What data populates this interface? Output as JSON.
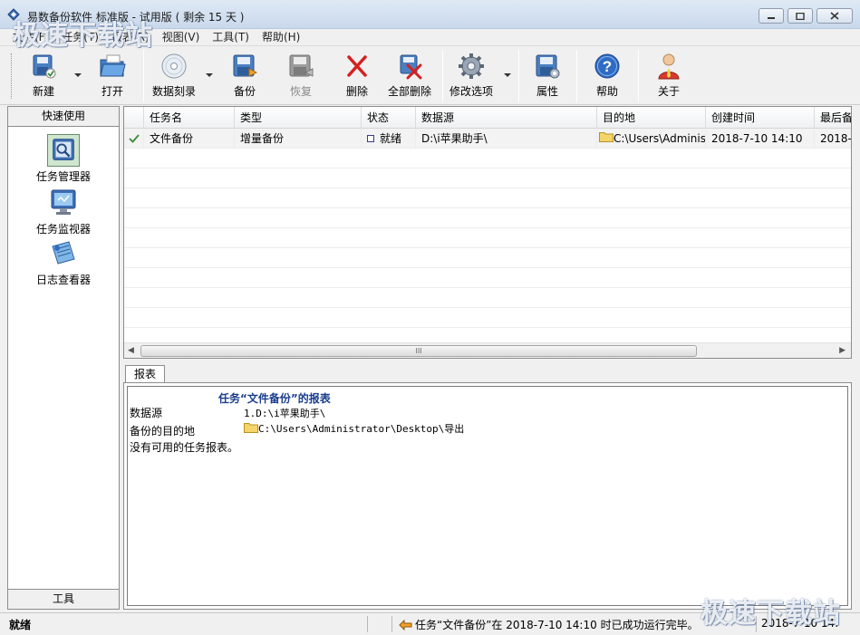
{
  "window": {
    "title": "易数备份软件 标准版 - 试用版 ( 剩余 15 天 )"
  },
  "menu": [
    "文件(F)",
    "任务(T)",
    "报表(R)",
    "视图(V)",
    "工具(T)",
    "帮助(H)"
  ],
  "toolbar": {
    "new": "新建",
    "open": "打开",
    "burn": "数据刻录",
    "backup": "备份",
    "restore": "恢复",
    "delete": "删除",
    "delete_all": "全部删除",
    "options": "修改选项",
    "properties": "属性",
    "help": "帮助",
    "about": "关于"
  },
  "sidebar": {
    "header": "快速使用",
    "items": [
      {
        "label": "任务管理器",
        "icon": "task-manager-icon"
      },
      {
        "label": "任务监视器",
        "icon": "task-monitor-icon"
      },
      {
        "label": "日志查看器",
        "icon": "log-viewer-icon"
      }
    ],
    "footer": "工具"
  },
  "table": {
    "columns": [
      "任务名",
      "类型",
      "状态",
      "数据源",
      "目的地",
      "创建时间",
      "最后备"
    ],
    "rows": [
      {
        "name": "文件备份",
        "type": "增量备份",
        "status": "就绪",
        "source": "D:\\i苹果助手\\",
        "destination": "C:\\Users\\Adminis",
        "created": "2018-7-10 14:10",
        "last": "2018-7"
      }
    ],
    "scroll_thumb_label": "III"
  },
  "report": {
    "tab": "报表",
    "title": "任务“文件备份”的报表",
    "source_label": "数据源",
    "source_value": "1.D:\\i苹果助手\\",
    "dest_label": "备份的目的地",
    "dest_value": "C:\\Users\\Administrator\\Desktop\\导出",
    "none": "没有可用的任务报表。"
  },
  "status": {
    "left": "就绪",
    "message": "任务“文件备份”在 2018-7-10 14:10 时已成功运行完毕。",
    "time": "2018-7-10 14:"
  },
  "watermark": "极速下载站",
  "colors": {
    "accent": "#1a3d8f",
    "check": "#3a8a3a",
    "delete_red": "#d42020"
  }
}
